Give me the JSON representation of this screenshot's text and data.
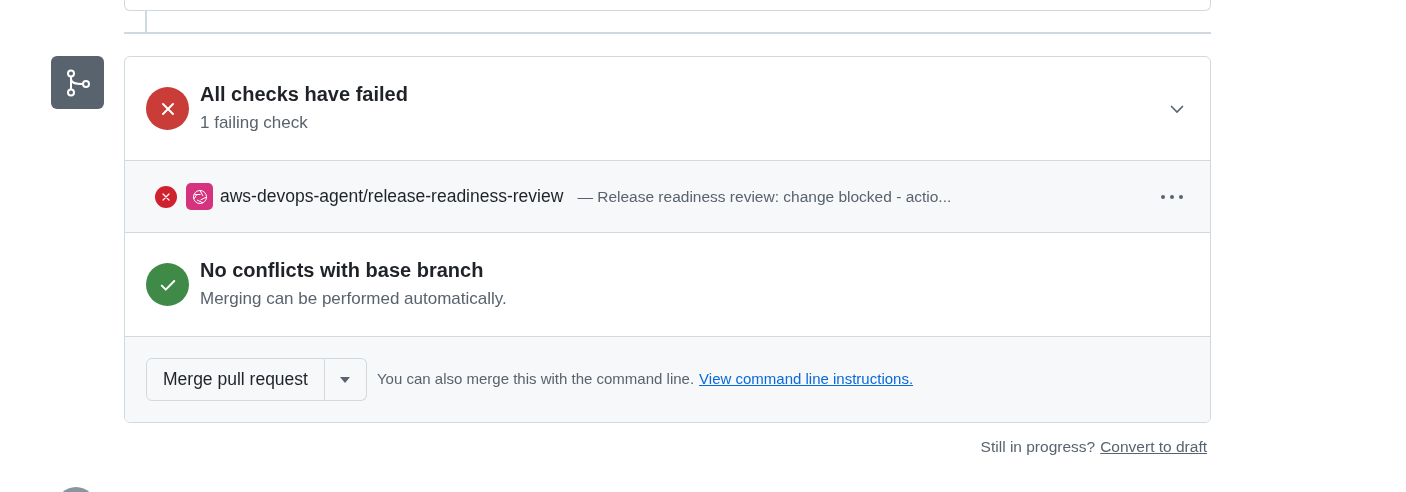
{
  "merge_box": {
    "sections": [
      {
        "kind": "failed",
        "title": "All checks have failed",
        "subtitle": "1 failing check",
        "expanded": false
      },
      {
        "kind": "success",
        "title": "No conflicts with base branch",
        "subtitle": "Merging can be performed automatically."
      }
    ],
    "checks": [
      {
        "failed": true,
        "name": "aws-devops-agent/release-readiness-review",
        "description": "— Release readiness review: change blocked - actio..."
      }
    ],
    "merge_button": "Merge pull request",
    "hint": "You can also merge this with the command line.",
    "hint_link": "View command line instructions."
  },
  "draft_prompt": "Still in progress?",
  "draft_link": "Convert to draft"
}
